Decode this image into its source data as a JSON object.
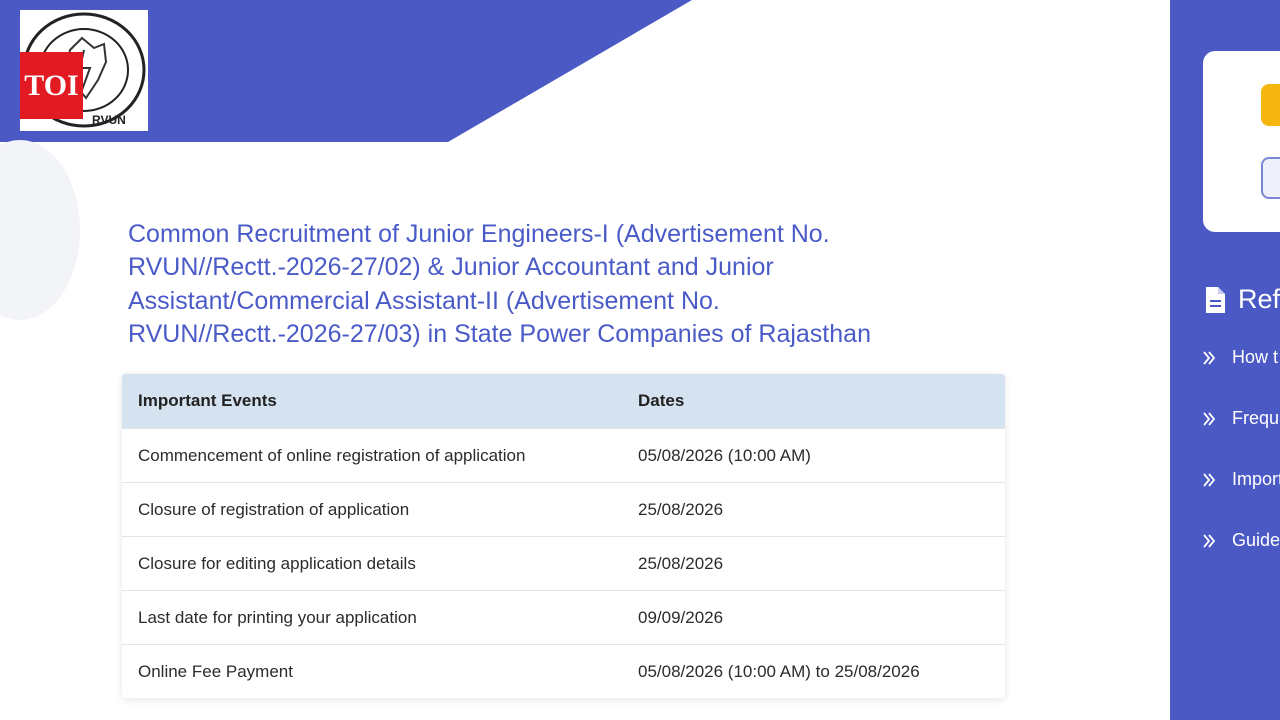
{
  "header": {
    "badge_text": "TOI",
    "logo_text": "RVUN",
    "colors": {
      "primary": "#4a59c4",
      "badge": "#e21b23",
      "accent": "#f5b60f"
    }
  },
  "notice": {
    "title": "Common Recruitment of Junior Engineers-I (Advertisement No. RVUN//Rectt.-2026-27/02) & Junior Accountant and Junior Assistant/Commercial Assistant-II (Advertisement No. RVUN//Rectt.-2026-27/03) in State Power Companies of Rajasthan"
  },
  "table": {
    "headers": [
      "Important Events",
      "Dates"
    ],
    "rows": [
      [
        "Commencement of online registration of application",
        "05/08/2026 (10:00 AM)"
      ],
      [
        "Closure of registration of application",
        "25/08/2026"
      ],
      [
        "Closure for editing application details",
        "25/08/2026"
      ],
      [
        "Last date for printing your application",
        "09/09/2026"
      ],
      [
        "Online Fee Payment",
        "05/08/2026 (10:00 AM) to 25/08/2026"
      ]
    ]
  },
  "sidebar": {
    "heading": "Ref",
    "heading_icon": "document-icon",
    "items": [
      {
        "label": "How t",
        "icon": "double-chevron-right-icon"
      },
      {
        "label": "Frequ",
        "icon": "double-chevron-right-icon"
      },
      {
        "label": "Import",
        "icon": "double-chevron-right-icon"
      },
      {
        "label": "Guide",
        "icon": "double-chevron-right-icon"
      }
    ]
  }
}
